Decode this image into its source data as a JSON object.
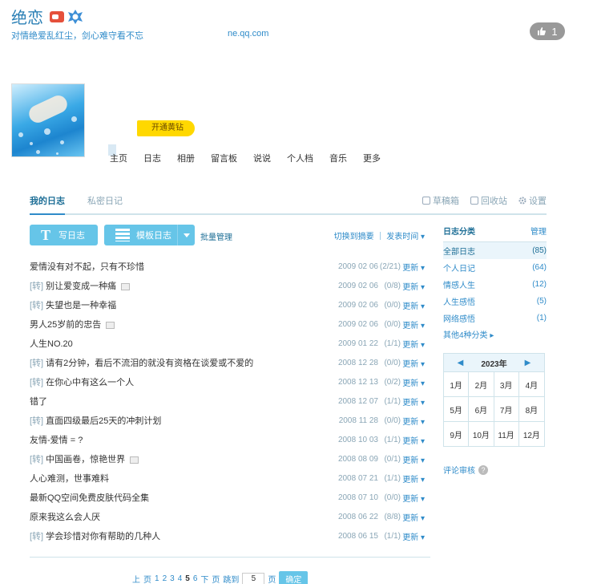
{
  "header": {
    "title": "绝恋",
    "subtitle": "对情绝爱乱红尘，剑心难守看不忘",
    "url": "ne.qq.com",
    "like_count": "1"
  },
  "promo": {
    "label": "开通黄钻"
  },
  "nav": [
    "主页",
    "日志",
    "相册",
    "留言板",
    "说说",
    "个人档",
    "音乐",
    "更多"
  ],
  "tabs": {
    "mine": "我的日志",
    "private": "私密日记",
    "drafts": "草稿箱",
    "recycle": "回收站",
    "settings": "设置"
  },
  "toolbar": {
    "write": "写日志",
    "write_icon": "T",
    "template": "模板日志",
    "batch": "批量管理",
    "sort": "切换到摘要 ｜ 发表时间 ▾"
  },
  "entries": [
    {
      "title": "爱情没有对不起，只有不珍惜",
      "repost": "",
      "img": false,
      "date": "2009 02 06",
      "count": "(2/21)",
      "more": "更新 ▾"
    },
    {
      "title": "别让爱变成一种痛",
      "repost": "[转] ",
      "img": true,
      "date": "2009 02 06",
      "count": "(0/8)",
      "more": "更新 ▾"
    },
    {
      "title": "失望也是一种幸福",
      "repost": "[转] ",
      "img": false,
      "date": "2009 02 06",
      "count": "(0/0)",
      "more": "更新 ▾"
    },
    {
      "title": "男人25岁前的忠告",
      "repost": "",
      "img": true,
      "date": "2009 02 06",
      "count": "(0/0)",
      "more": "更新 ▾"
    },
    {
      "title": "人生NO.20",
      "repost": "",
      "img": false,
      "date": "2009 01 22",
      "count": "(1/1)",
      "more": "更新 ▾"
    },
    {
      "title": "请有2分钟，看后不流泪的就没有资格在谈爱或不爱的",
      "repost": "[转] ",
      "img": false,
      "date": "2008 12 28",
      "count": "(0/0)",
      "more": "更新 ▾"
    },
    {
      "title": "在你心中有这么一个人",
      "repost": "[转] ",
      "img": false,
      "date": "2008 12 13",
      "count": "(0/2)",
      "more": "更新 ▾"
    },
    {
      "title": "错了",
      "repost": "",
      "img": false,
      "date": "2008 12 07",
      "count": "(1/1)",
      "more": "更新 ▾"
    },
    {
      "title": "直面四级最后25天的冲刺计划",
      "repost": "[转] ",
      "img": false,
      "date": "2008 11 28",
      "count": "(0/0)",
      "more": "更新 ▾"
    },
    {
      "title": "友情-爱情 = ?",
      "repost": "",
      "img": false,
      "date": "2008 10 03",
      "count": "(1/1)",
      "more": "更新 ▾"
    },
    {
      "title": "中国画卷，惊艳世界",
      "repost": "[转] ",
      "img": true,
      "date": "2008 08 09",
      "count": "(0/1)",
      "more": "更新 ▾"
    },
    {
      "title": "人心难测，世事难料",
      "repost": "",
      "img": false,
      "date": "2008 07 21",
      "count": "(1/1)",
      "more": "更新 ▾"
    },
    {
      "title": "最新QQ空间免费皮肤代码全集",
      "repost": "",
      "img": false,
      "date": "2008 07 10",
      "count": "(0/0)",
      "more": "更新 ▾"
    },
    {
      "title": "原来我这么会人厌",
      "repost": "",
      "img": false,
      "date": "2008 06 22",
      "count": "(8/8)",
      "more": "更新 ▾"
    },
    {
      "title": "学会珍惜对你有帮助的几种人",
      "repost": "[转] ",
      "img": false,
      "date": "2008 06 15",
      "count": "(1/1)",
      "more": "更新 ▾"
    }
  ],
  "pager": {
    "first": "上",
    "prev": "页",
    "pages": [
      "1",
      "2",
      "3",
      "4",
      "5",
      "6"
    ],
    "current": "5",
    "next": "下",
    "last": "页",
    "jump": "跳到",
    "input_value": "5",
    "unit": "页",
    "go": "确定"
  },
  "sidebar": {
    "heading": "日志分类",
    "manage": "管理",
    "categories": [
      {
        "name": "全部日志",
        "count": "(85)"
      },
      {
        "name": "个人日记",
        "count": "(64)"
      },
      {
        "name": "情感人生",
        "count": "(12)"
      },
      {
        "name": "人生感悟",
        "count": "(5)"
      },
      {
        "name": "网络感悟",
        "count": "(1)"
      }
    ],
    "more": "其他4种分类 ▸",
    "calendar_year": "2023年",
    "months": [
      "1月",
      "2月",
      "3月",
      "4月",
      "5月",
      "6月",
      "7月",
      "8月",
      "9月",
      "10月",
      "11月",
      "12月"
    ],
    "review": "评论审核"
  }
}
